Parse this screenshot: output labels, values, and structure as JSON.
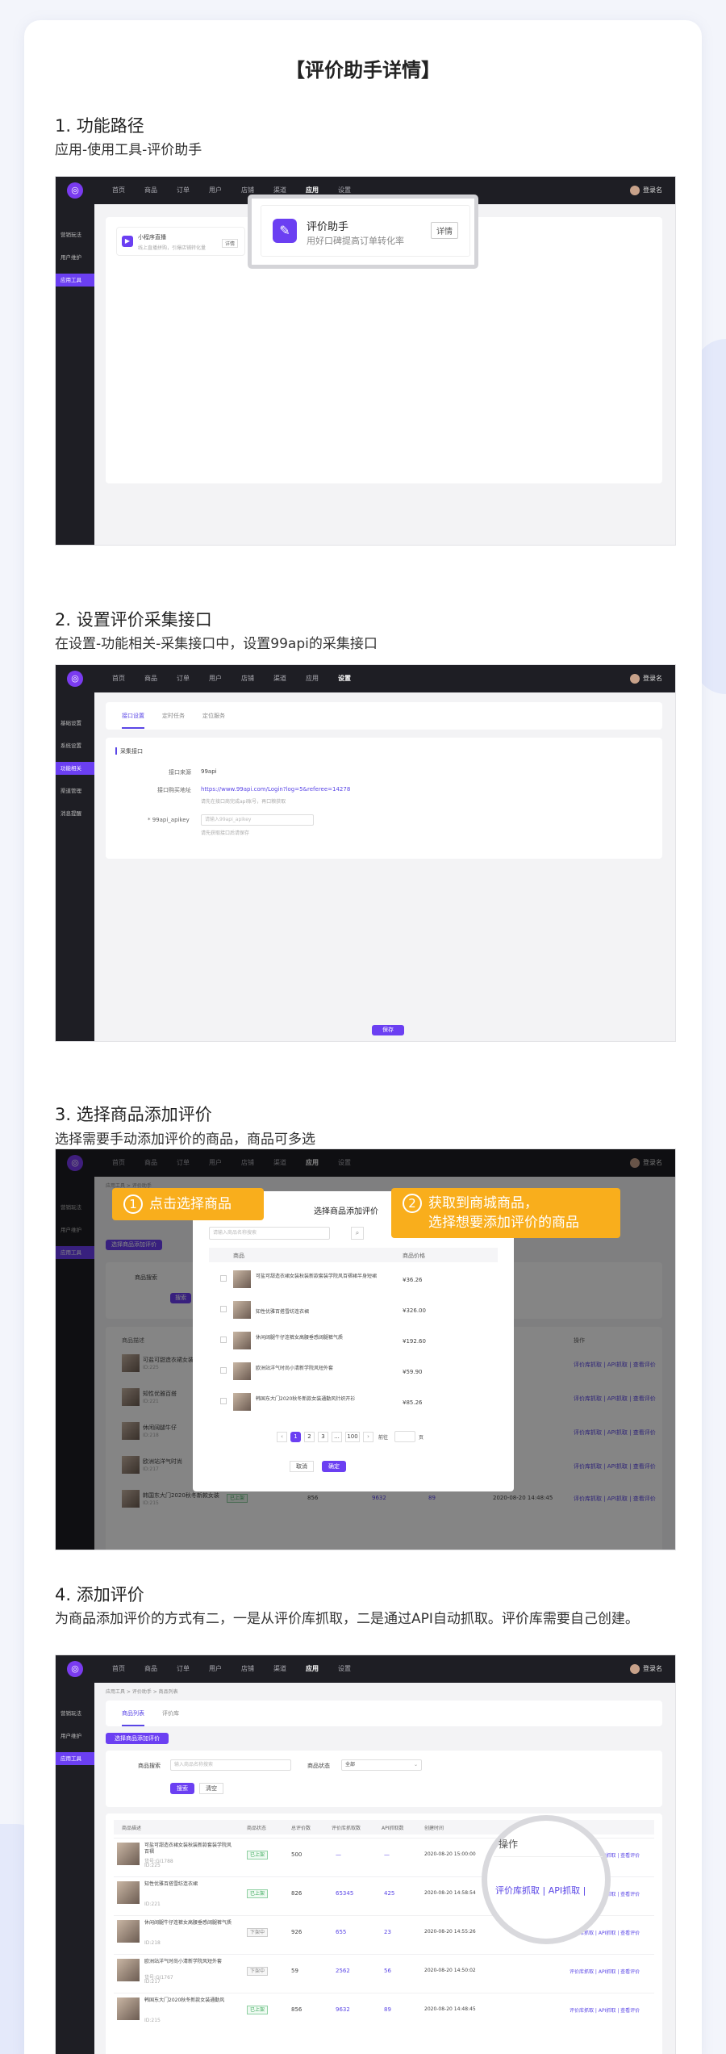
{
  "page_title": "【评价助手详情】",
  "nav_items": [
    "首页",
    "商品",
    "订单",
    "用户",
    "店铺",
    "渠道",
    "应用",
    "设置"
  ],
  "user_name": "登录名",
  "sections": [
    {
      "heading": "1. 功能路径",
      "desc": "应用-使用工具-评价助手"
    },
    {
      "heading": "2. 设置评价采集接口",
      "desc": "在设置-功能相关-采集接口中，设置99api的采集接口"
    },
    {
      "heading": "3. 选择商品添加评价",
      "desc": "选择需要手动添加评价的商品，商品可多选"
    },
    {
      "heading": "4. 添加评价",
      "desc": "为商品添加评价的方式有二，一是从评价库抓取，二是通过API自动抓取。评价库需要自己创建。"
    }
  ],
  "shot1": {
    "sidebar": [
      "营销玩法",
      "用户维护",
      "应用工具"
    ],
    "app_card": {
      "title": "小程序直播",
      "desc": "线上直播拼购，引爆店铺转化量",
      "btn": "详情"
    },
    "zoom": {
      "title": "评价助手",
      "desc": "用好口碑提高订单转化率",
      "btn": "详情"
    }
  },
  "shot2": {
    "sidebar": [
      "基础设置",
      "系统设置",
      "功能相关",
      "渠道管理",
      "消息提醒"
    ],
    "tabs": [
      "接口设置",
      "定时任务",
      "定位服务"
    ],
    "section_label": "采集接口",
    "source_label": "接口来源",
    "source_value": "99api",
    "url_label": "接口购买地址",
    "url_value": "https://www.99api.com/Login?log=5&referee=14278",
    "url_hint": "请先在接口商完成api账号，再口粮获取",
    "key_label": "* 99api_apikey",
    "key_placeholder": "请输入99api_apikey",
    "key_hint": "请先获取接口后请保存",
    "save": "保存"
  },
  "shot3": {
    "sidebar": [
      "营销玩法",
      "用户维护",
      "应用工具"
    ],
    "breadcrumb": "应用工具 > 评价助手",
    "add_btn": "选择商品添加评价",
    "search_label": "商品搜索",
    "search_btn": "搜索",
    "col_desc": "商品描述",
    "col_op": "操作",
    "callout1": {
      "num": "1",
      "text": "点击选择商品"
    },
    "callout2": {
      "num": "2",
      "line1": "获取到商城商品，",
      "line2": "选择想要添加评价的商品"
    },
    "modal": {
      "title": "选择商品添加评价",
      "search_placeholder": "请输入商品名称搜索",
      "col_goods": "商品",
      "col_price": "商品价格",
      "rows": [
        {
          "name": "可盐可甜造衣裙女装秋装新款套装学院风百褶裙半身短裙",
          "price": "¥36.26"
        },
        {
          "name": "知性优雅百搭雪纺连衣裙",
          "price": "¥326.00"
        },
        {
          "name": "休闲阔腿牛仔连裤女高腰垂感阔腿裤气质",
          "price": "¥192.60"
        },
        {
          "name": "欧洲站洋气时尚小清新学院风短外套",
          "price": "¥59.90"
        },
        {
          "name": "韩国东大门2020秋冬新款女装通勤风针织开衫",
          "price": "¥85.26"
        }
      ],
      "pages": [
        "1",
        "2",
        "3",
        "...",
        "100"
      ],
      "goto": "前往",
      "page_unit": "页",
      "cancel": "取消",
      "ok": "确定"
    },
    "bg_rows": [
      {
        "desc": "可盐可甜造衣裙女装",
        "id": "ID:225"
      },
      {
        "desc": "知性优雅百搭",
        "id": "ID:221"
      },
      {
        "desc": "休闲阔腿牛仔",
        "id": "ID:218"
      },
      {
        "desc": "欧洲站洋气时尚",
        "id": "ID:217"
      },
      {
        "desc": "韩国东大门2020秋冬新款女装",
        "id": "ID:215"
      }
    ],
    "bg_ops": "评价库抓取 | API抓取 | 查看评价",
    "bottom": {
      "tag": "已上架",
      "n1": "856",
      "n2": "9632",
      "n3": "89",
      "time": "2020-08-20 14:48:45"
    }
  },
  "shot4": {
    "sidebar": [
      "营销玩法",
      "用户维护",
      "应用工具"
    ],
    "breadcrumb": "应用工具 > 评价助手 > 商品列表",
    "tabs": [
      "商品列表",
      "评价库"
    ],
    "add_btn": "选择商品添加评价",
    "search_label": "商品搜索",
    "search_placeholder": "输入商品名称搜索",
    "status_label": "商品状态",
    "status_value": "全部",
    "search_btn": "搜索",
    "clear_btn": "清空",
    "cols": [
      "商品描述",
      "商品状态",
      "总评价数",
      "评价库抓取数",
      "API抓取数",
      "创建时间",
      "操作"
    ],
    "rows": [
      {
        "name": "可盐可甜造衣裙女装秋装新款套装学院风百褶",
        "sub": "货号:GI1788",
        "id": "ID:225",
        "status": "已上架",
        "total": "500",
        "lib": "—",
        "api": "—",
        "time": "2020-08-20 15:00:00",
        "on": true
      },
      {
        "name": "知性优雅百搭雪纺连衣裙",
        "sub": "",
        "id": "ID:221",
        "status": "已上架",
        "total": "826",
        "lib": "65345",
        "api": "425",
        "time": "2020-08-20 14:58:54",
        "on": true
      },
      {
        "name": "休闲阔腿牛仔连裤女高腰垂感阔腿裤气质",
        "sub": "",
        "id": "ID:218",
        "status": "下架中",
        "total": "926",
        "lib": "655",
        "api": "23",
        "time": "2020-08-20 14:55:26",
        "on": false
      },
      {
        "name": "欧洲站洋气时尚小清新学院风短外套",
        "sub": "货号:GI1767",
        "id": "ID:217",
        "status": "下架中",
        "total": "59",
        "lib": "2562",
        "api": "56",
        "time": "2020-08-20 14:50:02",
        "on": false
      },
      {
        "name": "韩国东大门2020秋冬新款女装通勤风",
        "sub": "",
        "id": "ID:215",
        "status": "已上架",
        "total": "856",
        "lib": "9632",
        "api": "89",
        "time": "2020-08-20 14:48:45",
        "on": true
      }
    ],
    "ops": "评价库抓取 | API抓取 | 查看评价",
    "zoom": {
      "header": "操作",
      "links": "评价库抓取 | API抓取 |"
    }
  }
}
